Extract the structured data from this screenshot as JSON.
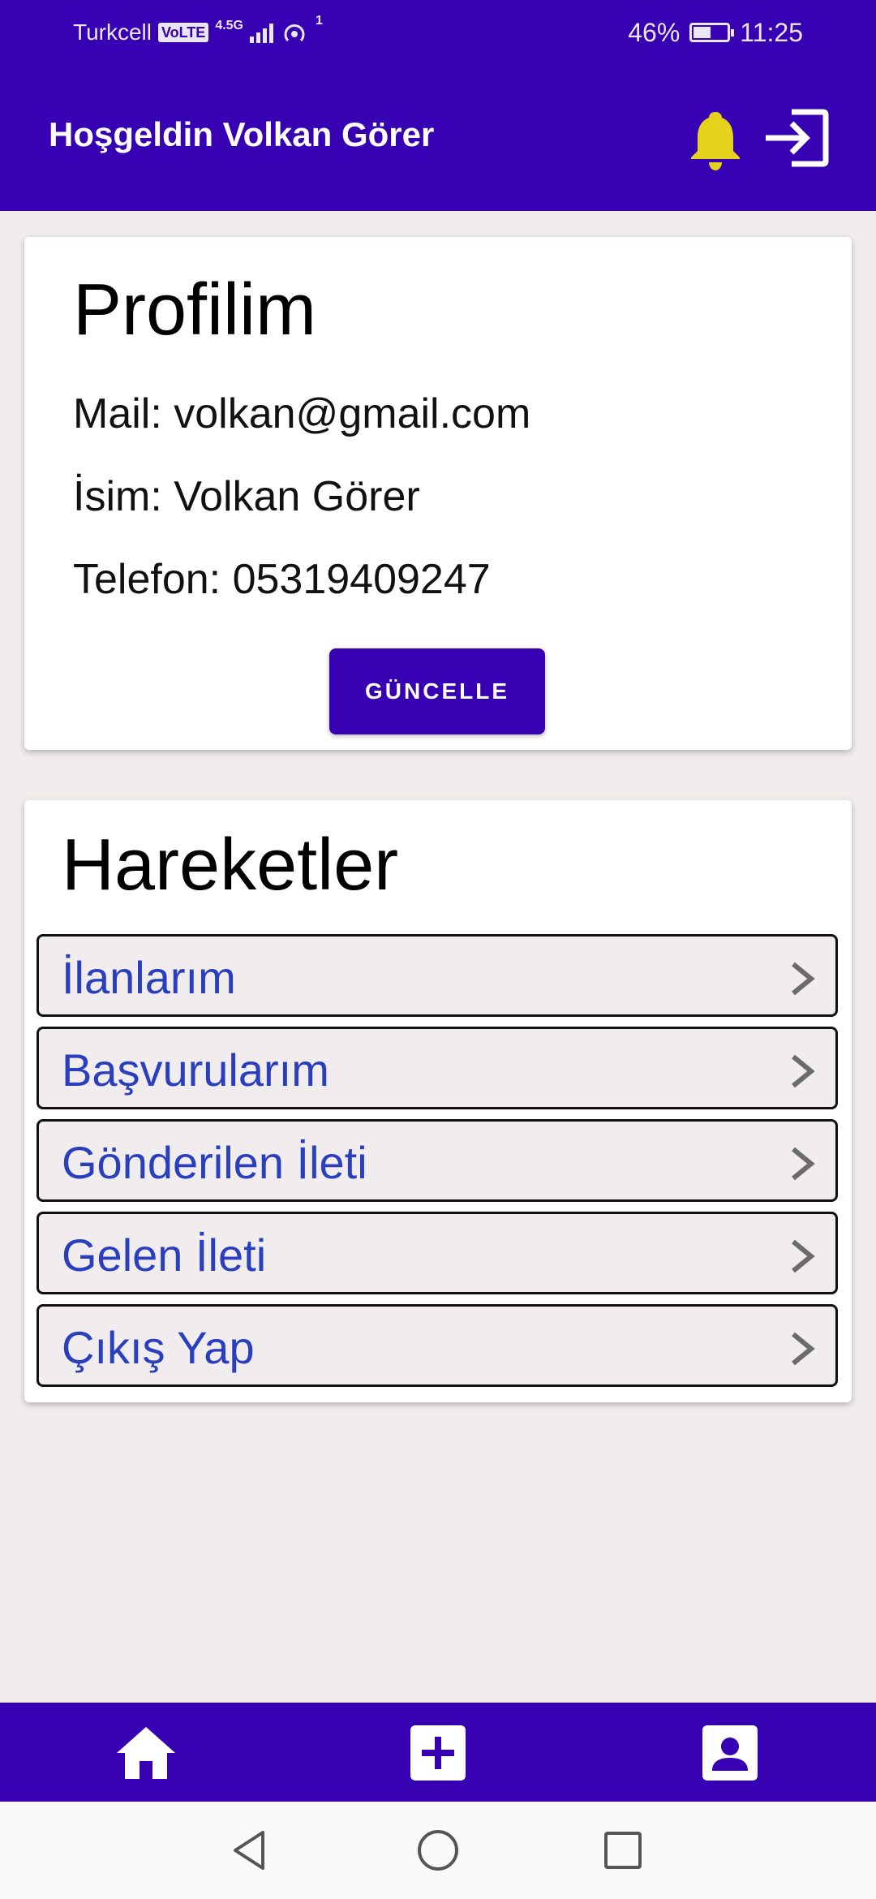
{
  "status_bar": {
    "carrier": "Turkcell",
    "volte": "VoLTE",
    "network": "4.5G",
    "hotspot_count": "1",
    "battery": "46%",
    "battery_level": 0.46,
    "time": "11:25"
  },
  "app_bar": {
    "title": "Hoşgeldin Volkan Görer",
    "icons": [
      "bell-icon",
      "logout-icon"
    ],
    "bell_color": "#e5d21c"
  },
  "profile": {
    "title": "Profilim",
    "mail": "Mail: volkan@gmail.com",
    "name": "İsim: Volkan Görer",
    "phone": "Telefon: 05319409247",
    "update_button": "GÜNCELLE"
  },
  "actions": {
    "title": "Hareketler",
    "items": [
      {
        "label": "İlanlarım"
      },
      {
        "label": "Başvurularım"
      },
      {
        "label": "Gönderilen İleti"
      },
      {
        "label": "Gelen İleti"
      },
      {
        "label": "Çıkış Yap"
      }
    ]
  },
  "bottom_nav": {
    "icons": [
      "home-icon",
      "add-box-icon",
      "account-box-icon"
    ]
  },
  "system_nav": {
    "icons": [
      "back-icon",
      "home-circle-icon",
      "recents-icon"
    ]
  },
  "colors": {
    "primary": "#3700b3",
    "link_text": "#2a3fbd",
    "background": "#f1eded"
  }
}
